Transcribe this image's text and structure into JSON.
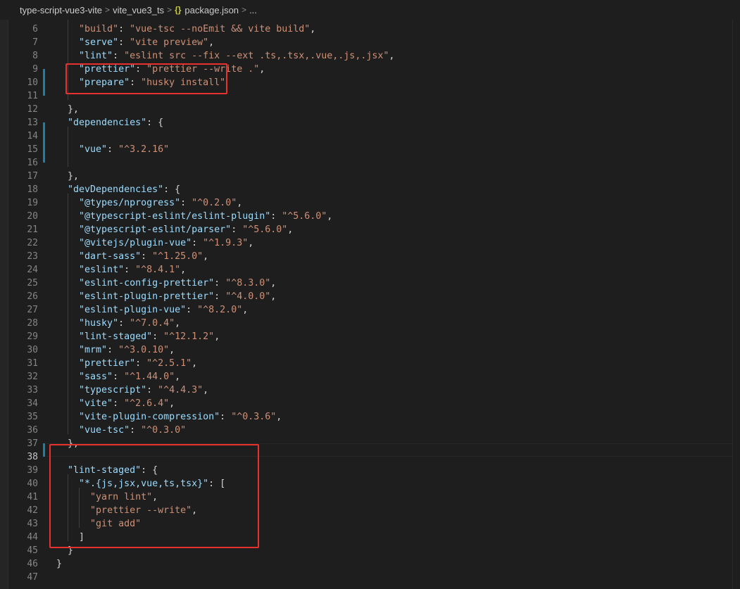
{
  "breadcrumb": {
    "items": [
      "type-script-vue3-vite",
      "vite_vue3_ts",
      "package.json",
      "..."
    ],
    "separator": ">",
    "file_icon": "{}"
  },
  "editor": {
    "current_line": 38,
    "lines": [
      {
        "num": 6,
        "tokens": [
          [
            "p",
            "    "
          ],
          [
            "s",
            "\"build\""
          ],
          [
            "p",
            ": "
          ],
          [
            "s",
            "\"vue-tsc --noEmit && vite build\""
          ],
          [
            "p",
            ","
          ]
        ]
      },
      {
        "num": 7,
        "tokens": [
          [
            "p",
            "    "
          ],
          [
            "k",
            "\"serve\""
          ],
          [
            "p",
            ": "
          ],
          [
            "s",
            "\"vite preview\""
          ],
          [
            "p",
            ","
          ]
        ]
      },
      {
        "num": 8,
        "tokens": [
          [
            "p",
            "    "
          ],
          [
            "k",
            "\"lint\""
          ],
          [
            "p",
            ": "
          ],
          [
            "s",
            "\"eslint src --fix --ext .ts,.tsx,.vue,.js,.jsx\""
          ],
          [
            "p",
            ","
          ]
        ]
      },
      {
        "num": 9,
        "tokens": [
          [
            "p",
            "    "
          ],
          [
            "k",
            "\"prettier\""
          ],
          [
            "p",
            ": "
          ],
          [
            "s",
            "\"prettier --write .\""
          ],
          [
            "p",
            ","
          ]
        ]
      },
      {
        "num": 10,
        "tokens": [
          [
            "p",
            "    "
          ],
          [
            "k",
            "\"prepare\""
          ],
          [
            "p",
            ": "
          ],
          [
            "s",
            "\"husky install\""
          ]
        ]
      },
      {
        "num": 11,
        "tokens": [
          [
            "p",
            ""
          ]
        ]
      },
      {
        "num": 12,
        "tokens": [
          [
            "p",
            "  },"
          ]
        ]
      },
      {
        "num": 13,
        "tokens": [
          [
            "p",
            "  "
          ],
          [
            "k",
            "\"dependencies\""
          ],
          [
            "p",
            ": {"
          ]
        ]
      },
      {
        "num": 14,
        "tokens": [
          [
            "p",
            ""
          ]
        ]
      },
      {
        "num": 15,
        "tokens": [
          [
            "p",
            "    "
          ],
          [
            "k",
            "\"vue\""
          ],
          [
            "p",
            ": "
          ],
          [
            "s",
            "\"^3.2.16\""
          ]
        ]
      },
      {
        "num": 16,
        "tokens": [
          [
            "p",
            ""
          ]
        ]
      },
      {
        "num": 17,
        "tokens": [
          [
            "p",
            "  },"
          ]
        ]
      },
      {
        "num": 18,
        "tokens": [
          [
            "p",
            "  "
          ],
          [
            "k",
            "\"devDependencies\""
          ],
          [
            "p",
            ": {"
          ]
        ]
      },
      {
        "num": 19,
        "tokens": [
          [
            "p",
            "    "
          ],
          [
            "k",
            "\"@types/nprogress\""
          ],
          [
            "p",
            ": "
          ],
          [
            "s",
            "\"^0.2.0\""
          ],
          [
            "p",
            ","
          ]
        ]
      },
      {
        "num": 20,
        "tokens": [
          [
            "p",
            "    "
          ],
          [
            "k",
            "\"@typescript-eslint/eslint-plugin\""
          ],
          [
            "p",
            ": "
          ],
          [
            "s",
            "\"^5.6.0\""
          ],
          [
            "p",
            ","
          ]
        ]
      },
      {
        "num": 21,
        "tokens": [
          [
            "p",
            "    "
          ],
          [
            "k",
            "\"@typescript-eslint/parser\""
          ],
          [
            "p",
            ": "
          ],
          [
            "s",
            "\"^5.6.0\""
          ],
          [
            "p",
            ","
          ]
        ]
      },
      {
        "num": 22,
        "tokens": [
          [
            "p",
            "    "
          ],
          [
            "k",
            "\"@vitejs/plugin-vue\""
          ],
          [
            "p",
            ": "
          ],
          [
            "s",
            "\"^1.9.3\""
          ],
          [
            "p",
            ","
          ]
        ]
      },
      {
        "num": 23,
        "tokens": [
          [
            "p",
            "    "
          ],
          [
            "k",
            "\"dart-sass\""
          ],
          [
            "p",
            ": "
          ],
          [
            "s",
            "\"^1.25.0\""
          ],
          [
            "p",
            ","
          ]
        ]
      },
      {
        "num": 24,
        "tokens": [
          [
            "p",
            "    "
          ],
          [
            "k",
            "\"eslint\""
          ],
          [
            "p",
            ": "
          ],
          [
            "s",
            "\"^8.4.1\""
          ],
          [
            "p",
            ","
          ]
        ]
      },
      {
        "num": 25,
        "tokens": [
          [
            "p",
            "    "
          ],
          [
            "k",
            "\"eslint-config-prettier\""
          ],
          [
            "p",
            ": "
          ],
          [
            "s",
            "\"^8.3.0\""
          ],
          [
            "p",
            ","
          ]
        ]
      },
      {
        "num": 26,
        "tokens": [
          [
            "p",
            "    "
          ],
          [
            "k",
            "\"eslint-plugin-prettier\""
          ],
          [
            "p",
            ": "
          ],
          [
            "s",
            "\"^4.0.0\""
          ],
          [
            "p",
            ","
          ]
        ]
      },
      {
        "num": 27,
        "tokens": [
          [
            "p",
            "    "
          ],
          [
            "k",
            "\"eslint-plugin-vue\""
          ],
          [
            "p",
            ": "
          ],
          [
            "s",
            "\"^8.2.0\""
          ],
          [
            "p",
            ","
          ]
        ]
      },
      {
        "num": 28,
        "tokens": [
          [
            "p",
            "    "
          ],
          [
            "k",
            "\"husky\""
          ],
          [
            "p",
            ": "
          ],
          [
            "s",
            "\"^7.0.4\""
          ],
          [
            "p",
            ","
          ]
        ]
      },
      {
        "num": 29,
        "tokens": [
          [
            "p",
            "    "
          ],
          [
            "k",
            "\"lint-staged\""
          ],
          [
            "p",
            ": "
          ],
          [
            "s",
            "\"^12.1.2\""
          ],
          [
            "p",
            ","
          ]
        ]
      },
      {
        "num": 30,
        "tokens": [
          [
            "p",
            "    "
          ],
          [
            "k",
            "\"mrm\""
          ],
          [
            "p",
            ": "
          ],
          [
            "s",
            "\"^3.0.10\""
          ],
          [
            "p",
            ","
          ]
        ]
      },
      {
        "num": 31,
        "tokens": [
          [
            "p",
            "    "
          ],
          [
            "k",
            "\"prettier\""
          ],
          [
            "p",
            ": "
          ],
          [
            "s",
            "\"^2.5.1\""
          ],
          [
            "p",
            ","
          ]
        ]
      },
      {
        "num": 32,
        "tokens": [
          [
            "p",
            "    "
          ],
          [
            "k",
            "\"sass\""
          ],
          [
            "p",
            ": "
          ],
          [
            "s",
            "\"^1.44.0\""
          ],
          [
            "p",
            ","
          ]
        ]
      },
      {
        "num": 33,
        "tokens": [
          [
            "p",
            "    "
          ],
          [
            "k",
            "\"typescript\""
          ],
          [
            "p",
            ": "
          ],
          [
            "s",
            "\"^4.4.3\""
          ],
          [
            "p",
            ","
          ]
        ]
      },
      {
        "num": 34,
        "tokens": [
          [
            "p",
            "    "
          ],
          [
            "k",
            "\"vite\""
          ],
          [
            "p",
            ": "
          ],
          [
            "s",
            "\"^2.6.4\""
          ],
          [
            "p",
            ","
          ]
        ]
      },
      {
        "num": 35,
        "tokens": [
          [
            "p",
            "    "
          ],
          [
            "k",
            "\"vite-plugin-compression\""
          ],
          [
            "p",
            ": "
          ],
          [
            "s",
            "\"^0.3.6\""
          ],
          [
            "p",
            ","
          ]
        ]
      },
      {
        "num": 36,
        "tokens": [
          [
            "p",
            "    "
          ],
          [
            "k",
            "\"vue-tsc\""
          ],
          [
            "p",
            ": "
          ],
          [
            "s",
            "\"^0.3.0\""
          ]
        ]
      },
      {
        "num": 37,
        "tokens": [
          [
            "p",
            "  },"
          ]
        ]
      },
      {
        "num": 38,
        "tokens": [
          [
            "p",
            ""
          ]
        ]
      },
      {
        "num": 39,
        "tokens": [
          [
            "p",
            "  "
          ],
          [
            "k",
            "\"lint-staged\""
          ],
          [
            "p",
            ": {"
          ]
        ]
      },
      {
        "num": 40,
        "tokens": [
          [
            "p",
            "    "
          ],
          [
            "k",
            "\"*.{js,jsx,vue,ts,tsx}\""
          ],
          [
            "p",
            ": ["
          ]
        ]
      },
      {
        "num": 41,
        "tokens": [
          [
            "p",
            "      "
          ],
          [
            "s",
            "\"yarn lint\""
          ],
          [
            "p",
            ","
          ]
        ]
      },
      {
        "num": 42,
        "tokens": [
          [
            "p",
            "      "
          ],
          [
            "s",
            "\"prettier --write\""
          ],
          [
            "p",
            ","
          ]
        ]
      },
      {
        "num": 43,
        "tokens": [
          [
            "p",
            "      "
          ],
          [
            "s",
            "\"git add\""
          ]
        ]
      },
      {
        "num": 44,
        "tokens": [
          [
            "p",
            "    ]"
          ]
        ]
      },
      {
        "num": 45,
        "tokens": [
          [
            "p",
            "  }"
          ]
        ]
      },
      {
        "num": 46,
        "tokens": [
          [
            "p",
            "}"
          ]
        ]
      },
      {
        "num": 47,
        "tokens": [
          [
            "p",
            ""
          ]
        ]
      }
    ]
  },
  "colors": {
    "background": "#1e1e1e",
    "key": "#9cdcfe",
    "string": "#ce9178",
    "punctuation": "#d4d4d4",
    "line_number": "#858585",
    "git_modified": "#1b81a8",
    "annotation_box": "#e8312f"
  }
}
